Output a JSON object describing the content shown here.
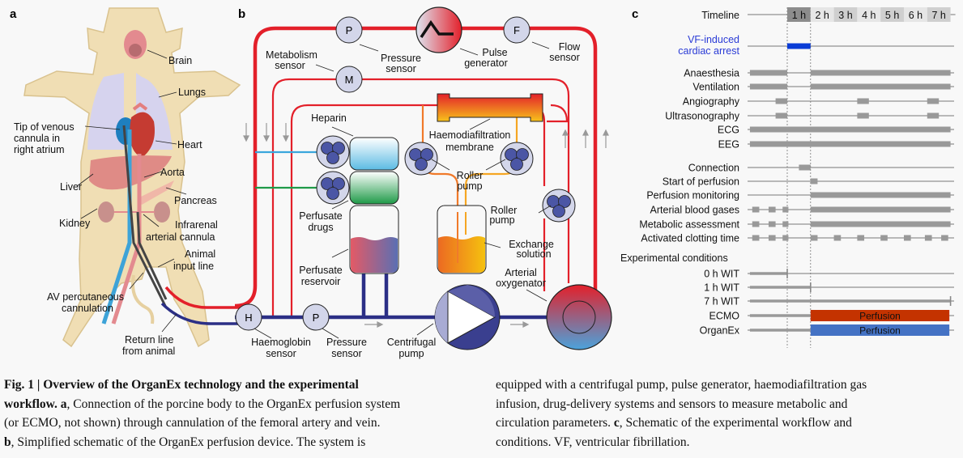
{
  "panel_a": {
    "letter": "a",
    "labels": {
      "brain": "Brain",
      "lungs": "Lungs",
      "tip_line1": "Tip of venous",
      "tip_line2": "cannula in",
      "tip_line3": "right atrium",
      "heart": "Heart",
      "aorta": "Aorta",
      "liver": "Liver",
      "pancreas": "Pancreas",
      "kidney": "Kidney",
      "infrarenal_line1": "Infrarenal",
      "infrarenal_line2": "arterial cannula",
      "animal_input_line1": "Animal",
      "animal_input_line2": "input line",
      "av_line1": "AV percutaneous",
      "av_line2": "cannulation",
      "return_line1": "Return line",
      "return_line2": "from animal"
    }
  },
  "panel_b": {
    "letter": "b",
    "sensor_glyphs": {
      "pressure_top": "P",
      "flow": "F",
      "metabolism": "M",
      "haemoglobin": "H",
      "pressure_bottom": "P"
    },
    "labels": {
      "pressure_top_1": "Pressure",
      "pressure_top_2": "sensor",
      "pulse_1": "Pulse",
      "pulse_2": "generator",
      "flow_1": "Flow",
      "flow_2": "sensor",
      "metab_1": "Metabolism",
      "metab_2": "sensor",
      "heparin": "Heparin",
      "hdf_1": "Haemodiafiltration",
      "hdf_2": "membrane",
      "roller_1": "Roller",
      "roller_2": "pump",
      "roller_right_1": "Roller",
      "roller_right_2": "pump",
      "drugs_1": "Perfusate",
      "drugs_2": "drugs",
      "exchange_1": "Exchange",
      "exchange_2": "solution",
      "reservoir_1": "Perfusate",
      "reservoir_2": "reservoir",
      "oxy_1": "Arterial",
      "oxy_2": "oxygenator",
      "hb_1": "Haemoglobin",
      "hb_2": "sensor",
      "pressure_bottom_1": "Pressure",
      "pressure_bottom_2": "sensor",
      "centrifugal_1": "Centrifugal",
      "centrifugal_2": "pump"
    },
    "colors": {
      "arterial": "#e3202a",
      "venous": "#2b2f86",
      "heparin": "#3aa6dc",
      "drugs": "#1f9a48",
      "exchange_in": "#f07a2a",
      "exchange_out": "#f5a623"
    }
  },
  "chart_data": {
    "type": "gantt",
    "title": "",
    "letter": "c",
    "timeline_label": "Timeline",
    "timeline_ticks": [
      "1 h",
      "2 h",
      "3 h",
      "4 h",
      "5 h",
      "6 h",
      "7 h"
    ],
    "x_unit": "hours",
    "x_range": [
      -1.6,
      7.2
    ],
    "dashed_markers": [
      0,
      1
    ],
    "rows": [
      {
        "label": "VF-induced cardiac arrest",
        "color": "#0a3cd6",
        "segments": [
          [
            0,
            1
          ]
        ]
      },
      {
        "label": "Anaesthesia",
        "segments": [
          [
            -1.6,
            0
          ],
          [
            1,
            7
          ]
        ]
      },
      {
        "label": "Ventilation",
        "segments": [
          [
            -1.6,
            0
          ],
          [
            1,
            7
          ]
        ]
      },
      {
        "label": "Angiography",
        "segments": [
          [
            -0.5,
            0
          ],
          [
            3,
            3.5
          ],
          [
            6,
            6.5
          ]
        ]
      },
      {
        "label": "Ultrasonography",
        "segments": [
          [
            -0.5,
            0
          ],
          [
            3,
            3.5
          ],
          [
            6,
            6.5
          ]
        ]
      },
      {
        "label": "ECG",
        "segments": [
          [
            -1.6,
            7
          ]
        ]
      },
      {
        "label": "EEG",
        "segments": [
          [
            -1.6,
            7
          ]
        ]
      },
      {
        "label": "Connection",
        "segments": [
          [
            0.5,
            1
          ]
        ]
      },
      {
        "label": "Start of perfusion",
        "segments": [
          [
            1,
            1.3
          ]
        ]
      },
      {
        "label": "Perfusion monitoring",
        "segments": [
          [
            1,
            7
          ]
        ]
      },
      {
        "label": "Arterial blood gases",
        "segments": [
          [
            -1.5,
            -1.2
          ],
          [
            -0.8,
            -0.5
          ],
          [
            -0.2,
            0.05
          ],
          [
            1,
            7
          ]
        ]
      },
      {
        "label": "Metabolic assessment",
        "segments": [
          [
            -1.5,
            -1.2
          ],
          [
            -0.8,
            -0.5
          ],
          [
            -0.2,
            0.05
          ],
          [
            1,
            7
          ]
        ]
      },
      {
        "label": "Activated clotting time",
        "segments": [
          [
            -1.5,
            -1.2
          ],
          [
            -0.8,
            -0.5
          ],
          [
            -0.2,
            0.05
          ],
          [
            1,
            1.3
          ],
          [
            2,
            2.3
          ],
          [
            3,
            3.3
          ],
          [
            4,
            4.3
          ],
          [
            5,
            5.3
          ],
          [
            5.9,
            6.2
          ],
          [
            6.6,
            6.9
          ]
        ]
      }
    ],
    "conditions_label": "Experimental conditions",
    "conditions": [
      {
        "label": "0 h WIT",
        "segments": [
          [
            -1.6,
            0
          ]
        ],
        "end_tick": 0
      },
      {
        "label": "1 h WIT",
        "segments": [
          [
            -1.6,
            1
          ]
        ],
        "end_tick": 1
      },
      {
        "label": "7 h WIT",
        "segments": [
          [
            -1.6,
            7
          ]
        ],
        "end_tick": 7
      },
      {
        "label": "ECMO",
        "segments": [
          [
            -1.6,
            1
          ]
        ],
        "block": {
          "range": [
            1,
            6.95
          ],
          "text": "Perfusion",
          "color": "#c43300"
        }
      },
      {
        "label": "OrganEx",
        "segments": [
          [
            -1.6,
            1
          ]
        ],
        "block": {
          "range": [
            1,
            6.95
          ],
          "text": "Perfusion",
          "color": "#4472c4"
        }
      }
    ]
  },
  "caption": {
    "fig_label": "Fig. 1 | Overview of the OrganEx technology and the experimental workflow.",
    "a_bold": "a",
    "a_text": ", Connection of the porcine body to the OrganEx perfusion system (or ECMO, not shown) through cannulation of the femoral artery and vein.",
    "b_bold": "b",
    "b_text": ", Simplified schematic of the OrganEx perfusion device. The system is equipped with a centrifugal pump, pulse generator, haemodiafiltration gas infusion, drug-delivery systems and sensors to measure metabolic and circulation parameters.",
    "c_bold": "c",
    "c_text": ", Schematic of the experimental workflow and conditions. VF, ventricular fibrillation.",
    "left_lines": [
      "Fig. 1 | Overview of the OrganEx technology and the experimental",
      "workflow.",
      ", Connection of the porcine body to the OrganEx perfusion system",
      "(or ECMO, not shown) through cannulation of the femoral artery and vein.",
      ", Simplified schematic of the OrganEx perfusion device. The system is"
    ],
    "right_lines": [
      "equipped with a centrifugal pump, pulse generator, haemodiafiltration gas",
      "infusion, drug-delivery systems and sensors to measure metabolic and",
      "circulation parameters.",
      ", Schematic of the experimental workflow and",
      "conditions. VF, ventricular fibrillation."
    ]
  }
}
